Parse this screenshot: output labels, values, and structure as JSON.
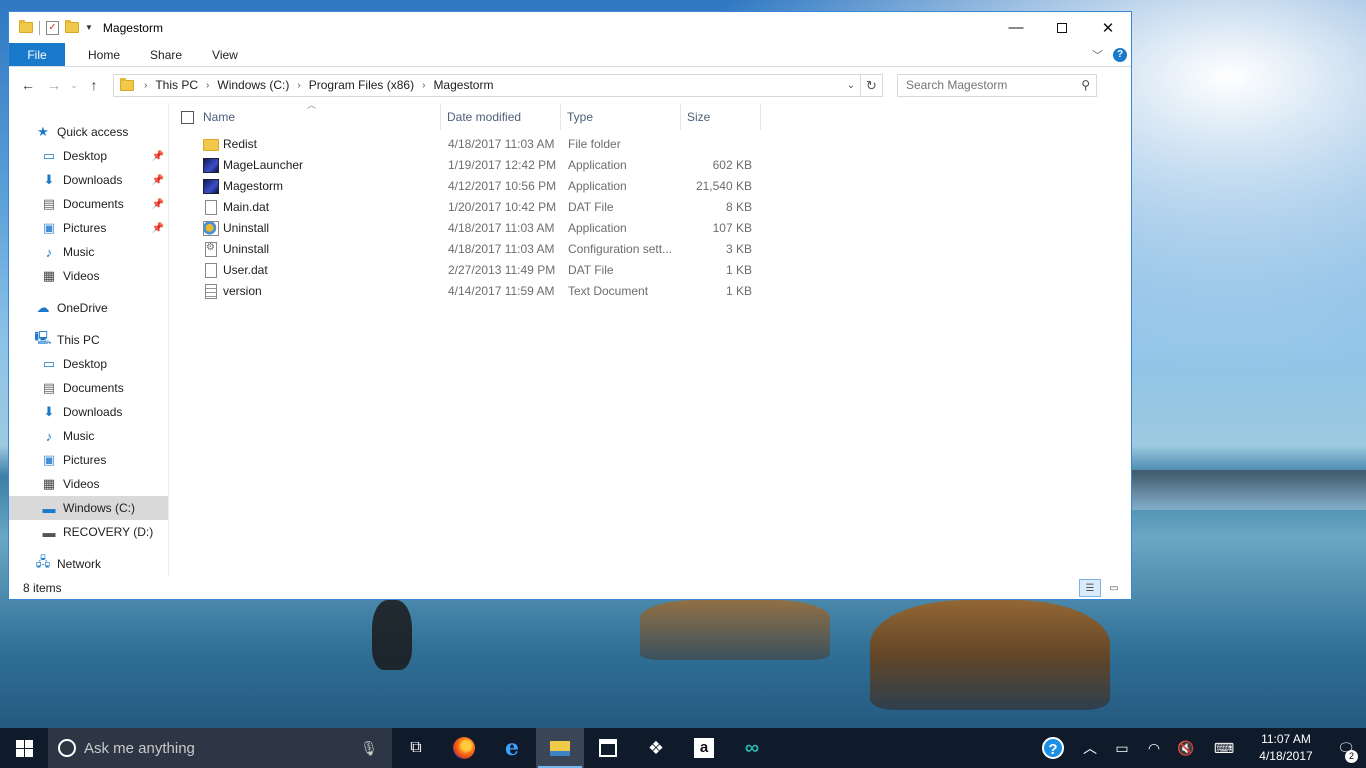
{
  "window": {
    "title": "Magestorm"
  },
  "ribbon": {
    "tabs": [
      "File",
      "Home",
      "Share",
      "View"
    ]
  },
  "address": {
    "crumbs": [
      "This PC",
      "Windows (C:)",
      "Program Files (x86)",
      "Magestorm"
    ],
    "search_placeholder": "Search Magestorm"
  },
  "nav": {
    "quick_access": "Quick access",
    "quick_items": [
      "Desktop",
      "Downloads",
      "Documents",
      "Pictures",
      "Music",
      "Videos"
    ],
    "onedrive": "OneDrive",
    "this_pc": "This PC",
    "pc_items": [
      "Desktop",
      "Documents",
      "Downloads",
      "Music",
      "Pictures",
      "Videos",
      "Windows (C:)",
      "RECOVERY (D:)"
    ],
    "network": "Network"
  },
  "columns": [
    "Name",
    "Date modified",
    "Type",
    "Size"
  ],
  "files": [
    {
      "name": "Redist",
      "date": "4/18/2017 11:03 AM",
      "type": "File folder",
      "size": "",
      "icon": "folder-icon"
    },
    {
      "name": "MageLauncher",
      "date": "1/19/2017 12:42 PM",
      "type": "Application",
      "size": "602 KB",
      "icon": "app-icon"
    },
    {
      "name": "Magestorm",
      "date": "4/12/2017 10:56 PM",
      "type": "Application",
      "size": "21,540 KB",
      "icon": "app-icon"
    },
    {
      "name": "Main.dat",
      "date": "1/20/2017 10:42 PM",
      "type": "DAT File",
      "size": "8 KB",
      "icon": "file-icon"
    },
    {
      "name": "Uninstall",
      "date": "4/18/2017 11:03 AM",
      "type": "Application",
      "size": "107 KB",
      "icon": "setup-icon"
    },
    {
      "name": "Uninstall",
      "date": "4/18/2017 11:03 AM",
      "type": "Configuration sett...",
      "size": "3 KB",
      "icon": "config-icon"
    },
    {
      "name": "User.dat",
      "date": "2/27/2013 11:49 PM",
      "type": "DAT File",
      "size": "1 KB",
      "icon": "file-icon"
    },
    {
      "name": "version",
      "date": "4/14/2017 11:59 AM",
      "type": "Text Document",
      "size": "1 KB",
      "icon": "text-document-icon"
    }
  ],
  "status": {
    "item_count": "8 items"
  },
  "taskbar": {
    "search_placeholder": "Ask me anything",
    "time": "11:07 AM",
    "date": "4/18/2017",
    "notification_count": "2"
  }
}
